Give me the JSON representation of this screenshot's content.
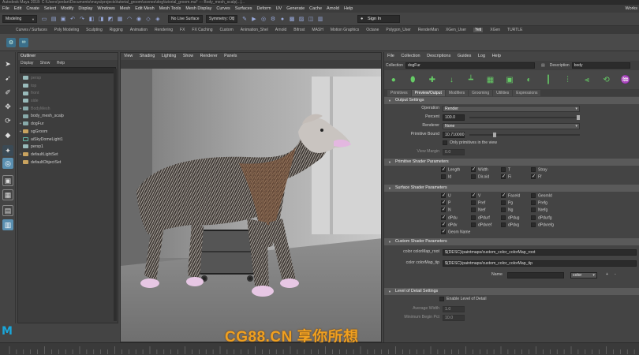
{
  "window": {
    "title": "Autodesk Maya 2018: C:\\Users\\jordan\\Documents\\maya\\projects\\tutorial_groom\\scenes\\dog\\tutorial_groom.ma* --- Body_mesh_scalp|...|..."
  },
  "menubar": {
    "items": [
      "File",
      "Edit",
      "Create",
      "Select",
      "Modify",
      "Display",
      "Windows",
      "Mesh",
      "Edit Mesh",
      "Mesh Tools",
      "Mesh Display",
      "Curves",
      "Surfaces",
      "Deform",
      "UV",
      "Generate",
      "Cache",
      "Arnold",
      "Help"
    ],
    "workspace": "Works"
  },
  "statusline": {
    "menuset": "Modeling",
    "live_surface": "No Live Surface",
    "symmetry": "Symmetry: Off",
    "sign_in": "Sign In"
  },
  "shelf": {
    "tabs": [
      "Curves / Surfaces",
      "Poly Modeling",
      "Sculpting",
      "Rigging",
      "Animation",
      "Rendering",
      "FX",
      "FX Caching",
      "Custom",
      "Animation_Shel",
      "Arnold",
      "Bifrost",
      "MASH",
      "Motion Graphics",
      "Octane",
      "Polygon_User",
      "RenderMan",
      "XGen_User",
      "Yeti",
      "XGen",
      "TURTLE"
    ],
    "active_tab": "Yeti"
  },
  "outliner": {
    "title": "Outliner",
    "menus": [
      "Display",
      "Show",
      "Help"
    ],
    "items": [
      {
        "label": "persp",
        "type": "cam",
        "dim": true,
        "expand": ""
      },
      {
        "label": "top",
        "type": "cam",
        "dim": true,
        "expand": ""
      },
      {
        "label": "front",
        "type": "cam",
        "dim": true,
        "expand": ""
      },
      {
        "label": "side",
        "type": "cam",
        "dim": true,
        "expand": ""
      },
      {
        "label": "BodyMesh",
        "type": "mesh",
        "dim": true,
        "expand": "+"
      },
      {
        "label": "body_mesh_scalp",
        "type": "mesh",
        "dim": false,
        "expand": ""
      },
      {
        "label": "dogFur",
        "type": "mesh",
        "dim": false,
        "expand": "+"
      },
      {
        "label": "sgGroom",
        "type": "grp",
        "dim": false,
        "expand": "+"
      },
      {
        "label": "aiSkyDomeLight1",
        "type": "curve",
        "dim": false,
        "expand": ""
      },
      {
        "label": "persp1",
        "type": "cam",
        "dim": false,
        "expand": ""
      },
      {
        "label": "defaultLightSet",
        "type": "grp",
        "dim": false,
        "expand": "+"
      },
      {
        "label": "defaultObjectSet",
        "type": "grp",
        "dim": false,
        "expand": ""
      }
    ]
  },
  "viewport": {
    "menus": [
      "View",
      "Shading",
      "Lighting",
      "Show",
      "Renderer",
      "Panels"
    ]
  },
  "attribute_editor": {
    "menus": [
      "File",
      "Collection",
      "Descriptions",
      "Guides",
      "Log",
      "Help"
    ],
    "collection_label": "Collection",
    "collection_value": "dogFur",
    "description_label": "Description",
    "description_value": "body",
    "tabs": [
      "Primitives",
      "Preview/Output",
      "Modifiers",
      "Grooming",
      "Utilities",
      "Expressions"
    ],
    "active_tab": "Preview/Output",
    "output_settings": {
      "title": "Output Settings",
      "operation_label": "Operation",
      "operation_value": "Render",
      "percent_label": "Percent",
      "percent_value": "100.0",
      "renderer_label": "Renderer",
      "renderer_value": "None",
      "primitive_bound_label": "Primitive Bound",
      "primitive_bound_value": "10.710000",
      "only_primitives_label": "Only primitives in the view",
      "view_margin_label": "View Margin",
      "view_margin_value": "0.0"
    },
    "primitive_shader": {
      "title": "Primitive Shader Parameters",
      "checks": [
        {
          "label": "Length",
          "on": true,
          "col": 0,
          "row": 0
        },
        {
          "label": "Width",
          "on": true,
          "col": 1,
          "row": 0
        },
        {
          "label": "T",
          "on": false,
          "col": 2,
          "row": 0
        },
        {
          "label": "Stray",
          "on": false,
          "col": 3,
          "row": 0
        },
        {
          "label": "Id",
          "on": false,
          "col": 0,
          "row": 1
        },
        {
          "label": "Dir.oid",
          "on": false,
          "col": 1,
          "row": 1
        },
        {
          "label": "Fi",
          "on": true,
          "col": 2,
          "row": 1
        },
        {
          "label": "Ff",
          "on": true,
          "col": 3,
          "row": 1
        }
      ]
    },
    "surface_shader": {
      "title": "Surface Shader Parameters",
      "checks": [
        {
          "label": "U",
          "on": true,
          "col": 0,
          "row": 0
        },
        {
          "label": "V",
          "on": true,
          "col": 1,
          "row": 0
        },
        {
          "label": "FaceId",
          "on": true,
          "col": 2,
          "row": 0
        },
        {
          "label": "GeomId",
          "on": false,
          "col": 3,
          "row": 0
        },
        {
          "label": "P",
          "on": true,
          "col": 0,
          "row": 1
        },
        {
          "label": "Pref",
          "on": false,
          "col": 1,
          "row": 1
        },
        {
          "label": "Pg",
          "on": false,
          "col": 2,
          "row": 1
        },
        {
          "label": "Prefg",
          "on": false,
          "col": 3,
          "row": 1
        },
        {
          "label": "N",
          "on": true,
          "col": 0,
          "row": 2
        },
        {
          "label": "Nref",
          "on": false,
          "col": 1,
          "row": 2
        },
        {
          "label": "Ng",
          "on": false,
          "col": 2,
          "row": 2
        },
        {
          "label": "Nrefg",
          "on": false,
          "col": 3,
          "row": 2
        },
        {
          "label": "dPdu",
          "on": true,
          "col": 0,
          "row": 3
        },
        {
          "label": "dPdurf",
          "on": false,
          "col": 1,
          "row": 3
        },
        {
          "label": "dPdug",
          "on": false,
          "col": 2,
          "row": 3
        },
        {
          "label": "dPdurfg",
          "on": false,
          "col": 3,
          "row": 3
        },
        {
          "label": "dPdv",
          "on": true,
          "col": 0,
          "row": 4
        },
        {
          "label": "dPdvref",
          "on": false,
          "col": 1,
          "row": 4
        },
        {
          "label": "dPdvg",
          "on": false,
          "col": 2,
          "row": 4
        },
        {
          "label": "dPdvrefg",
          "on": false,
          "col": 3,
          "row": 4
        },
        {
          "label": "Geom Name",
          "on": true,
          "col": 0,
          "row": 5
        }
      ]
    },
    "custom_shader": {
      "title": "Custom Shader Parameters",
      "root_label": "color colorMap_root",
      "root_value": "$(DESC)/paintmaps/custom_color_colorMap_root",
      "tip_label": "color colorMap_tip",
      "tip_value": "$(DESC)/paintmaps/custom_color_colorMap_tip",
      "name_label": "Name",
      "type_value": "color",
      "add_label": "+",
      "remove_label": "-"
    },
    "lod": {
      "title": "Level of Detail Settings",
      "enable_label": "Enable Level of Detail",
      "average_width_label": "Average Width",
      "average_width_value": "1.0",
      "min_label": "Minimum Begin Pct",
      "min_value": "10.0"
    }
  },
  "watermark": "CG88.CN 享你所想",
  "logo": "M",
  "colors": {
    "accent": "#5a8fb0",
    "watermark": "#f0a020",
    "logo": "#1aa6d9"
  }
}
